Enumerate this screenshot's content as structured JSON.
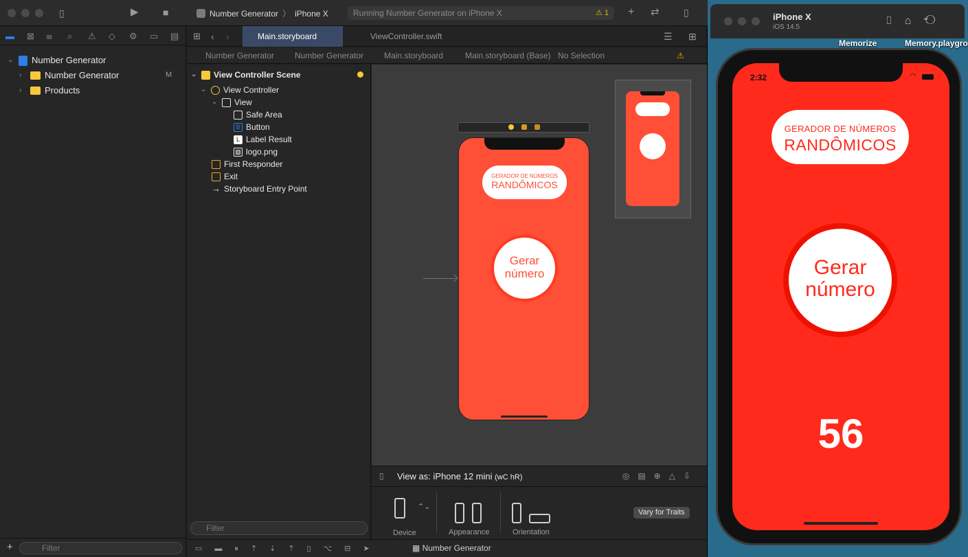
{
  "xcode": {
    "scheme": {
      "project": "Number Generator",
      "device": "iPhone X"
    },
    "status": {
      "text": "Running Number Generator on iPhone X",
      "warnings": "1"
    },
    "navigator": {
      "items": [
        {
          "label": "Number Generator",
          "badge": ""
        },
        {
          "label": "Number Generator",
          "badge": "M"
        },
        {
          "label": "Products",
          "badge": ""
        }
      ],
      "filter_placeholder": "Filter"
    },
    "tabs": [
      {
        "label": "Main.storyboard"
      },
      {
        "label": "ViewController.swift"
      }
    ],
    "jumpbar": [
      "Number Generator",
      "Number Generator",
      "Main.storyboard",
      "Main.storyboard (Base)",
      "No Selection"
    ],
    "outline": {
      "scene": "View Controller Scene",
      "view_controller": "View Controller",
      "view": "View",
      "children": [
        "Safe Area",
        "Button",
        "Label Result",
        "logo.png"
      ],
      "first_responder": "First Responder",
      "exit": "Exit",
      "entry_point": "Storyboard Entry Point",
      "filter_placeholder": "Filter"
    },
    "storyboard": {
      "title_line1": "GERADOR DE NÚMEROS",
      "title_line2": "RANDÔMICOS",
      "button_line1": "Gerar",
      "button_line2": "número"
    },
    "view_as": {
      "label": "View as: iPhone 12 mini",
      "size_class": "(wC hR)",
      "device": "Device",
      "appearance": "Appearance",
      "orientation": "Orientation",
      "vary": "Vary for Traits"
    },
    "debug_target": "Number Generator"
  },
  "desktop": {
    "label1": "Memorize",
    "label2": "Memory.playgro"
  },
  "simulator": {
    "title": "iPhone X",
    "ios": "iOS 14.5",
    "time": "2:32",
    "title_line1": "GERADOR DE NÚMEROS",
    "title_line2": "RANDÔMICOS",
    "button_line1": "Gerar",
    "button_line2": "número",
    "result": "56"
  },
  "colors": {
    "app_red": "#ff2a1c",
    "storyboard_red": "#ff4f36",
    "accent_blue": "#2f7de8"
  }
}
